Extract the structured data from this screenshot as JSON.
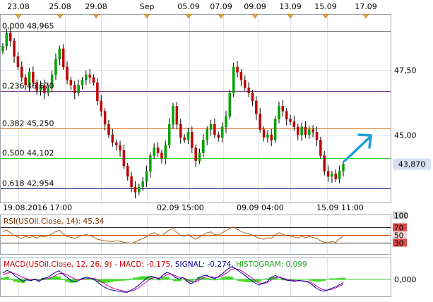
{
  "chart_data": [
    {
      "type": "candlestick",
      "panel": "price",
      "date_markers": [
        "23.08",
        "25.08",
        "29.08",
        "Sep",
        "05.09",
        "07.09",
        "09.09",
        "13.09",
        "15.09",
        "17.09"
      ],
      "x_labels": [
        "19.08.2016 17:00",
        "02.09 15:00",
        "09.09 04:00",
        "15.09 11:00"
      ],
      "y_ticks": [
        "47,50",
        "45,00"
      ],
      "last_price": "43,870",
      "fibonacci_levels": [
        {
          "ratio": "0,000",
          "price": "48,965",
          "color": "#808080"
        },
        {
          "ratio": "0,236",
          "price": "46,670",
          "color": "#7b2d8b"
        },
        {
          "ratio": "0,382",
          "price": "45,250",
          "color": "#e07820"
        },
        {
          "ratio": "0,500",
          "price": "44,102",
          "color": "#33cc33"
        },
        {
          "ratio": "0,618",
          "price": "42,954",
          "color": "#1a2a7a"
        }
      ],
      "close_series": [
        48.4,
        48.9,
        48.6,
        48.0,
        47.6,
        47.2,
        46.9,
        47.4,
        47.0,
        46.7,
        46.9,
        46.6,
        46.8,
        47.3,
        47.9,
        48.3,
        47.6,
        47.1,
        46.9,
        46.6,
        46.9,
        47.1,
        47.3,
        47.2,
        47.0,
        46.3,
        45.9,
        45.4,
        45.0,
        44.7,
        44.6,
        44.4,
        43.8,
        43.4,
        43.0,
        42.8,
        43.0,
        43.2,
        43.6,
        44.2,
        44.5,
        44.3,
        44.1,
        44.6,
        45.4,
        46.1,
        45.4,
        44.9,
        44.8,
        45.1,
        44.5,
        44.0,
        44.3,
        44.8,
        45.2,
        45.4,
        45.0,
        44.9,
        45.3,
        45.7,
        46.6,
        47.6,
        47.4,
        47.1,
        46.8,
        46.6,
        46.3,
        45.8,
        45.2,
        44.9,
        45.0,
        44.8,
        45.6,
        46.1,
        45.9,
        45.6,
        45.5,
        45.3,
        45.0,
        45.3,
        45.0,
        45.2,
        45.1,
        44.8,
        44.2,
        43.6,
        43.4,
        43.5,
        43.3,
        43.6,
        43.87
      ],
      "ylim": [
        42.4,
        49.6
      ],
      "color_up": "#00a000",
      "color_down": "#c00000"
    },
    {
      "type": "line",
      "panel": "rsi",
      "label": "RSI(USOil.Close, 14): 45,34",
      "value": 45.34,
      "levels": [
        "100",
        "70",
        "50",
        "30"
      ],
      "level_values": [
        100,
        70,
        50,
        30
      ],
      "ylim": [
        0,
        100
      ],
      "values": [
        58,
        62,
        55,
        48,
        44,
        40,
        46,
        42,
        45,
        41,
        46,
        44,
        48,
        52,
        58,
        61,
        52,
        45,
        43,
        40,
        45,
        48,
        50,
        47,
        44,
        38,
        36,
        34,
        33,
        32,
        34,
        33,
        30,
        29,
        28,
        31,
        36,
        40,
        44,
        52,
        55,
        50,
        47,
        55,
        62,
        66,
        55,
        48,
        46,
        50,
        43,
        38,
        44,
        50,
        55,
        57,
        50,
        49,
        55,
        60,
        66,
        70,
        64,
        58,
        54,
        52,
        48,
        44,
        40,
        38,
        42,
        40,
        50,
        55,
        51,
        47,
        46,
        44,
        41,
        46,
        42,
        45,
        43,
        40,
        34,
        30,
        29,
        32,
        30,
        40,
        45.34
      ],
      "color": "#b06010"
    },
    {
      "type": "line",
      "panel": "macd",
      "label": "MACD(USOil.Close, 12, 26, 9) - MACD: -0,175, SIGNAL: -0,274, HISTOGRAM: 0,099",
      "label_macd": "MACD(USOil.Close, 12, 26, 9) - MACD: -0,175,",
      "label_signal": "SIGNAL: -0,274,",
      "label_hist": "HISTOGRAM: 0,099",
      "y_ticks": [
        "0,000"
      ],
      "ylim": [
        -0.9,
        0.9
      ],
      "series": [
        {
          "values": [
            0.35,
            0.5,
            0.42,
            0.2,
            0.05,
            -0.1,
            -0.02,
            -0.08,
            0.02,
            -0.12,
            0.05,
            0.1,
            0.22,
            0.38,
            0.48,
            0.3,
            0.12,
            -0.05,
            -0.15,
            -0.05,
            0.08,
            0.12,
            0.05,
            -0.02,
            -0.22,
            -0.38,
            -0.5,
            -0.58,
            -0.62,
            -0.66,
            -0.7,
            -0.72,
            -0.6,
            -0.48,
            -0.3,
            -0.1,
            0.08,
            0.18,
            0.1,
            0.02,
            0.25,
            0.4,
            0.3,
            0.12,
            0.02,
            0.1,
            -0.1,
            -0.25,
            -0.1,
            0.1,
            0.2,
            0.22,
            0.1,
            0.05,
            0.18,
            0.35,
            0.55,
            0.7,
            0.62,
            0.45,
            0.3,
            0.12,
            -0.05,
            -0.2,
            -0.32,
            -0.2,
            -0.12,
            0.1,
            0.22,
            0.12,
            0.02,
            -0.05,
            -0.08,
            -0.1,
            -0.05,
            -0.1,
            -0.12,
            -0.25,
            -0.45,
            -0.58,
            -0.65,
            -0.6,
            -0.5,
            -0.42,
            -0.3,
            -0.175
          ],
          "color": "#000099"
        },
        {
          "values": [
            0.25,
            0.35,
            0.38,
            0.32,
            0.22,
            0.1,
            0.04,
            -0.02,
            -0.02,
            -0.05,
            -0.02,
            0.03,
            0.1,
            0.2,
            0.32,
            0.34,
            0.26,
            0.14,
            0.02,
            -0.04,
            0.0,
            0.06,
            0.07,
            0.04,
            -0.06,
            -0.18,
            -0.32,
            -0.44,
            -0.52,
            -0.58,
            -0.63,
            -0.67,
            -0.65,
            -0.58,
            -0.45,
            -0.28,
            -0.1,
            0.05,
            0.1,
            0.07,
            0.14,
            0.26,
            0.3,
            0.22,
            0.12,
            0.1,
            0.0,
            -0.12,
            -0.14,
            -0.04,
            0.08,
            0.15,
            0.14,
            0.1,
            0.13,
            0.23,
            0.38,
            0.55,
            0.6,
            0.55,
            0.42,
            0.27,
            0.1,
            -0.06,
            -0.2,
            -0.22,
            -0.18,
            -0.04,
            0.1,
            0.12,
            0.07,
            0.01,
            -0.04,
            -0.07,
            -0.07,
            -0.08,
            -0.1,
            -0.17,
            -0.32,
            -0.46,
            -0.57,
            -0.6,
            -0.56,
            -0.48,
            -0.38,
            -0.274
          ],
          "color": "#cc0099"
        }
      ],
      "histogram_color": "#44dd22",
      "zero_line_color": "#33cc33"
    }
  ]
}
